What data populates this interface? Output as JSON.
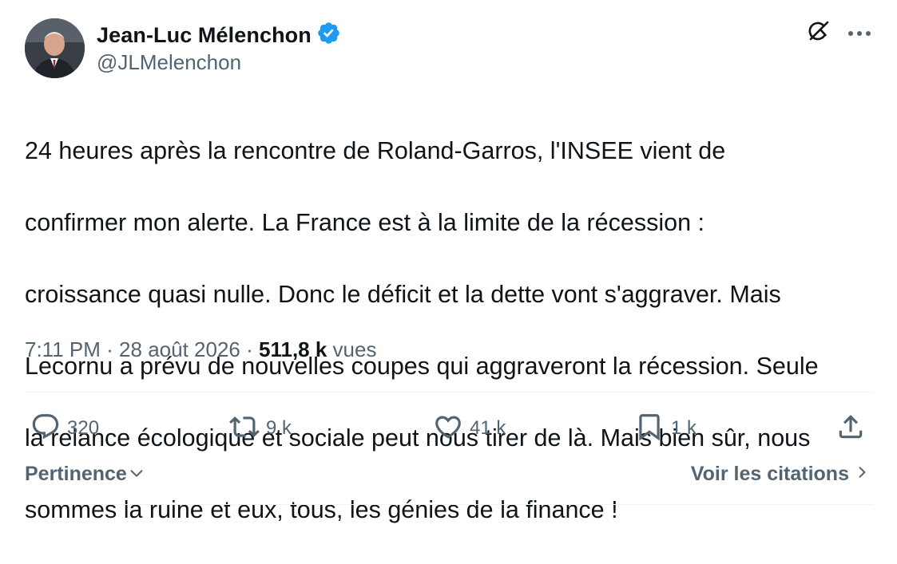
{
  "author": {
    "display_name": "Jean-Luc Mélenchon",
    "handle": "@JLMelenchon",
    "verified": true
  },
  "tweet": {
    "lines": [
      "24 heures après la rencontre de Roland-Garros, l'INSEE vient de",
      "confirmer mon alerte. La France est à la limite de la récession :",
      "croissance quasi nulle. Donc le déficit et la dette vont s'aggraver. Mais",
      "Lecornu a prévu de nouvelles coupes qui aggraveront la récession. Seule",
      "la relance écologique et sociale peut nous tirer de là. Mais bien sûr, nous",
      "sommes la ruine et eux, tous, les génies de la finance !"
    ],
    "time": "7:11 PM",
    "separator": "·",
    "date": "28 août 2026",
    "views_count": "511,8 k",
    "views_label": "vues"
  },
  "actions": {
    "replies": "320",
    "reposts": "9 k",
    "likes": "41 k",
    "bookmarks": "1 k"
  },
  "footer": {
    "sort_label": "Pertinence",
    "quotes_label": "Voir les citations"
  },
  "icons": {
    "verified": "verified-badge-icon",
    "grok": "grok-icon",
    "more": "more-icon",
    "reply": "reply-icon",
    "repost": "repost-icon",
    "like": "like-icon",
    "bookmark": "bookmark-icon",
    "share": "share-icon"
  },
  "colors": {
    "text": "#0f1419",
    "secondary": "#536471",
    "verified": "#1d9bf0",
    "divider": "#eff3f4"
  }
}
